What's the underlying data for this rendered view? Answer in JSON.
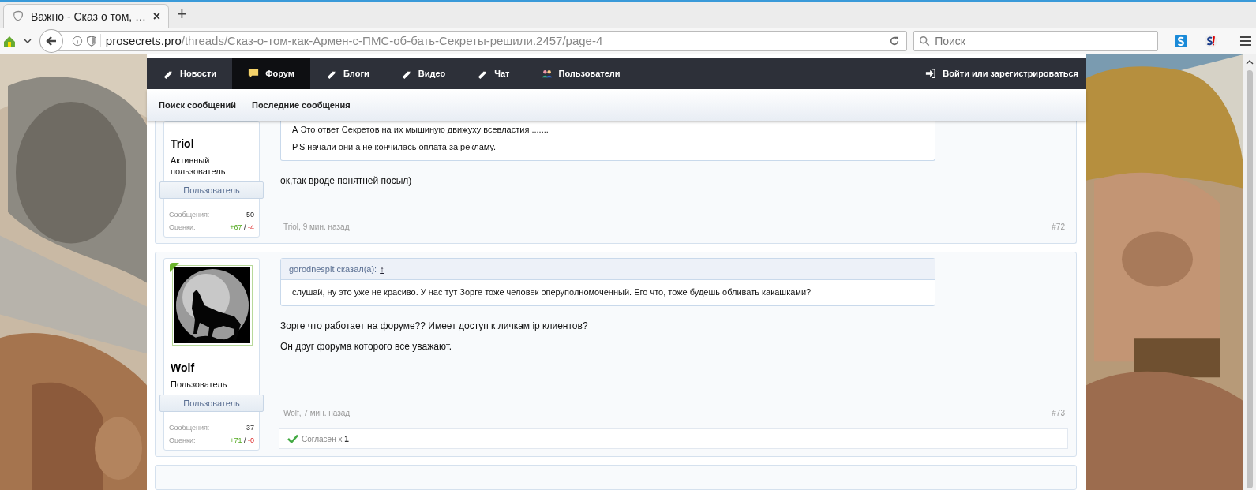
{
  "browser": {
    "tab": {
      "title": "Важно - Сказ о том, …",
      "close": "×"
    },
    "new_tab": "+",
    "url": {
      "host": "prosecrets.pro",
      "path": "/threads/Сказ-о-том-как-Армен-с-ПМС-об-бать-Секреты-решили.2457/page-4"
    },
    "search": {
      "placeholder": "Поиск"
    }
  },
  "nav": {
    "items": [
      {
        "label": "Новости",
        "kind": "tag",
        "selected": false
      },
      {
        "label": "Форум",
        "kind": "bubble",
        "selected": true
      },
      {
        "label": "Блоги",
        "kind": "tag",
        "selected": false
      },
      {
        "label": "Видео",
        "kind": "tag",
        "selected": false
      },
      {
        "label": "Чат",
        "kind": "tag",
        "selected": false
      },
      {
        "label": "Пользователи",
        "kind": "users",
        "selected": false
      }
    ],
    "login": "Войти или зарегистрироваться"
  },
  "subnav": [
    "Поиск сообщений",
    "Последние сообщения"
  ],
  "posts": [
    {
      "user": {
        "name": "Triol",
        "title": "Активный пользователь",
        "banner": "Пользователь",
        "stats": {
          "messages_label": "Сообщения:",
          "messages": "50",
          "ratings_label": "Оценки:",
          "plus": "+67",
          "separator": "/",
          "minus": "-4"
        }
      },
      "quote": {
        "lines": [
          "А Это ответ Секретов на их мышиную движуху всевластия .......",
          "P.S начали они а не кончилась оплата за рекламу."
        ]
      },
      "body": [
        "ок,так вроде понятней посыл)"
      ],
      "meta": "Triol, 9 мин. назад",
      "number": "#72"
    },
    {
      "user": {
        "name": "Wolf",
        "title": "Пользователь",
        "banner": "Пользователь",
        "online": true,
        "stats": {
          "messages_label": "Сообщения:",
          "messages": "37",
          "ratings_label": "Оценки:",
          "plus": "+71",
          "separator": "/",
          "minus": "-0"
        }
      },
      "quote": {
        "author": "gorodnespit сказал(а):",
        "jump": "↑",
        "lines": [
          "слушай, ну это уже не красиво. У нас тут Зорге тоже человек оперуполномоченный. Его что, тоже будешь обливать какашками?"
        ]
      },
      "body": [
        "Зорге что работает на форуме?? Имеет доступ к личкам ip клиентов?",
        "Он друг форума которого все уважают."
      ],
      "meta": "Wolf, 7 мин. назад",
      "number": "#73",
      "likes": {
        "label": "Согласен х",
        "count": "1"
      }
    }
  ]
}
